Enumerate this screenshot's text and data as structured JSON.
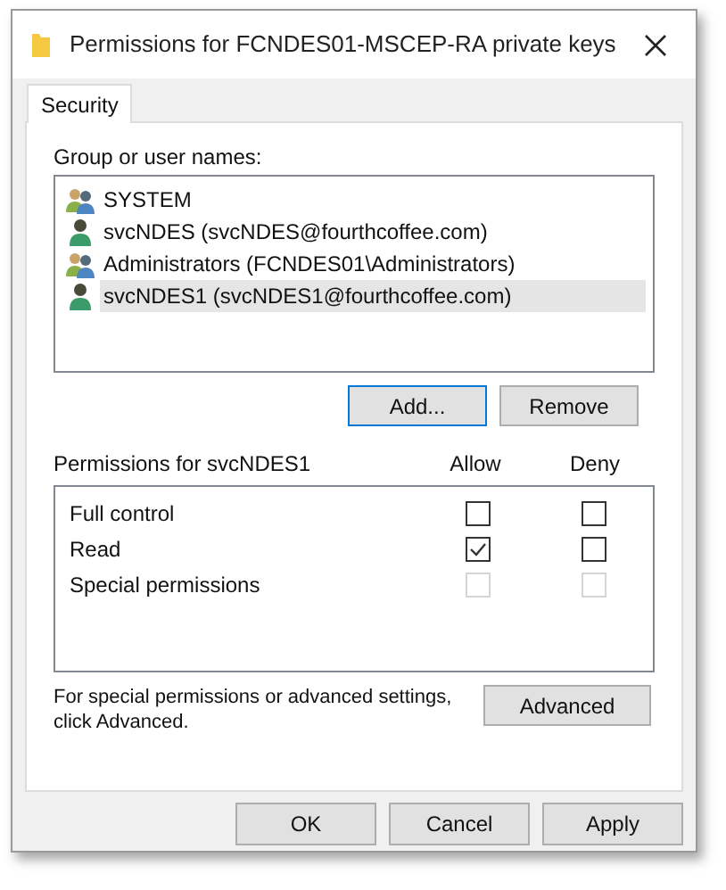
{
  "window": {
    "title": "Permissions for FCNDES01-MSCEP-RA private keys"
  },
  "tabs": [
    {
      "label": "Security",
      "selected": true
    }
  ],
  "group_list": {
    "label": "Group or user names:",
    "items": [
      {
        "name": "SYSTEM",
        "kind": "group",
        "selected": false
      },
      {
        "name": "svcNDES (svcNDES@fourthcoffee.com)",
        "kind": "user",
        "selected": false
      },
      {
        "name": "Administrators (FCNDES01\\Administrators)",
        "kind": "group",
        "selected": false
      },
      {
        "name": "svcNDES1 (svcNDES1@fourthcoffee.com)",
        "kind": "user",
        "selected": true
      }
    ]
  },
  "list_buttons": [
    {
      "label": "Add...",
      "focused": true
    },
    {
      "label": "Remove",
      "focused": false
    }
  ],
  "permissions": {
    "label": "Permissions for svcNDES1",
    "columns": [
      "Allow",
      "Deny"
    ],
    "rows": [
      {
        "name": "Full control",
        "allow": {
          "checked": false,
          "disabled": false
        },
        "deny": {
          "checked": false,
          "disabled": false
        }
      },
      {
        "name": "Read",
        "allow": {
          "checked": true,
          "disabled": false
        },
        "deny": {
          "checked": false,
          "disabled": false
        }
      },
      {
        "name": "Special permissions",
        "allow": {
          "checked": false,
          "disabled": true
        },
        "deny": {
          "checked": false,
          "disabled": true
        }
      }
    ]
  },
  "advanced": {
    "text": "For special permissions or advanced settings, click Advanced.",
    "button": "Advanced"
  },
  "footer_buttons": [
    "OK",
    "Cancel",
    "Apply"
  ]
}
